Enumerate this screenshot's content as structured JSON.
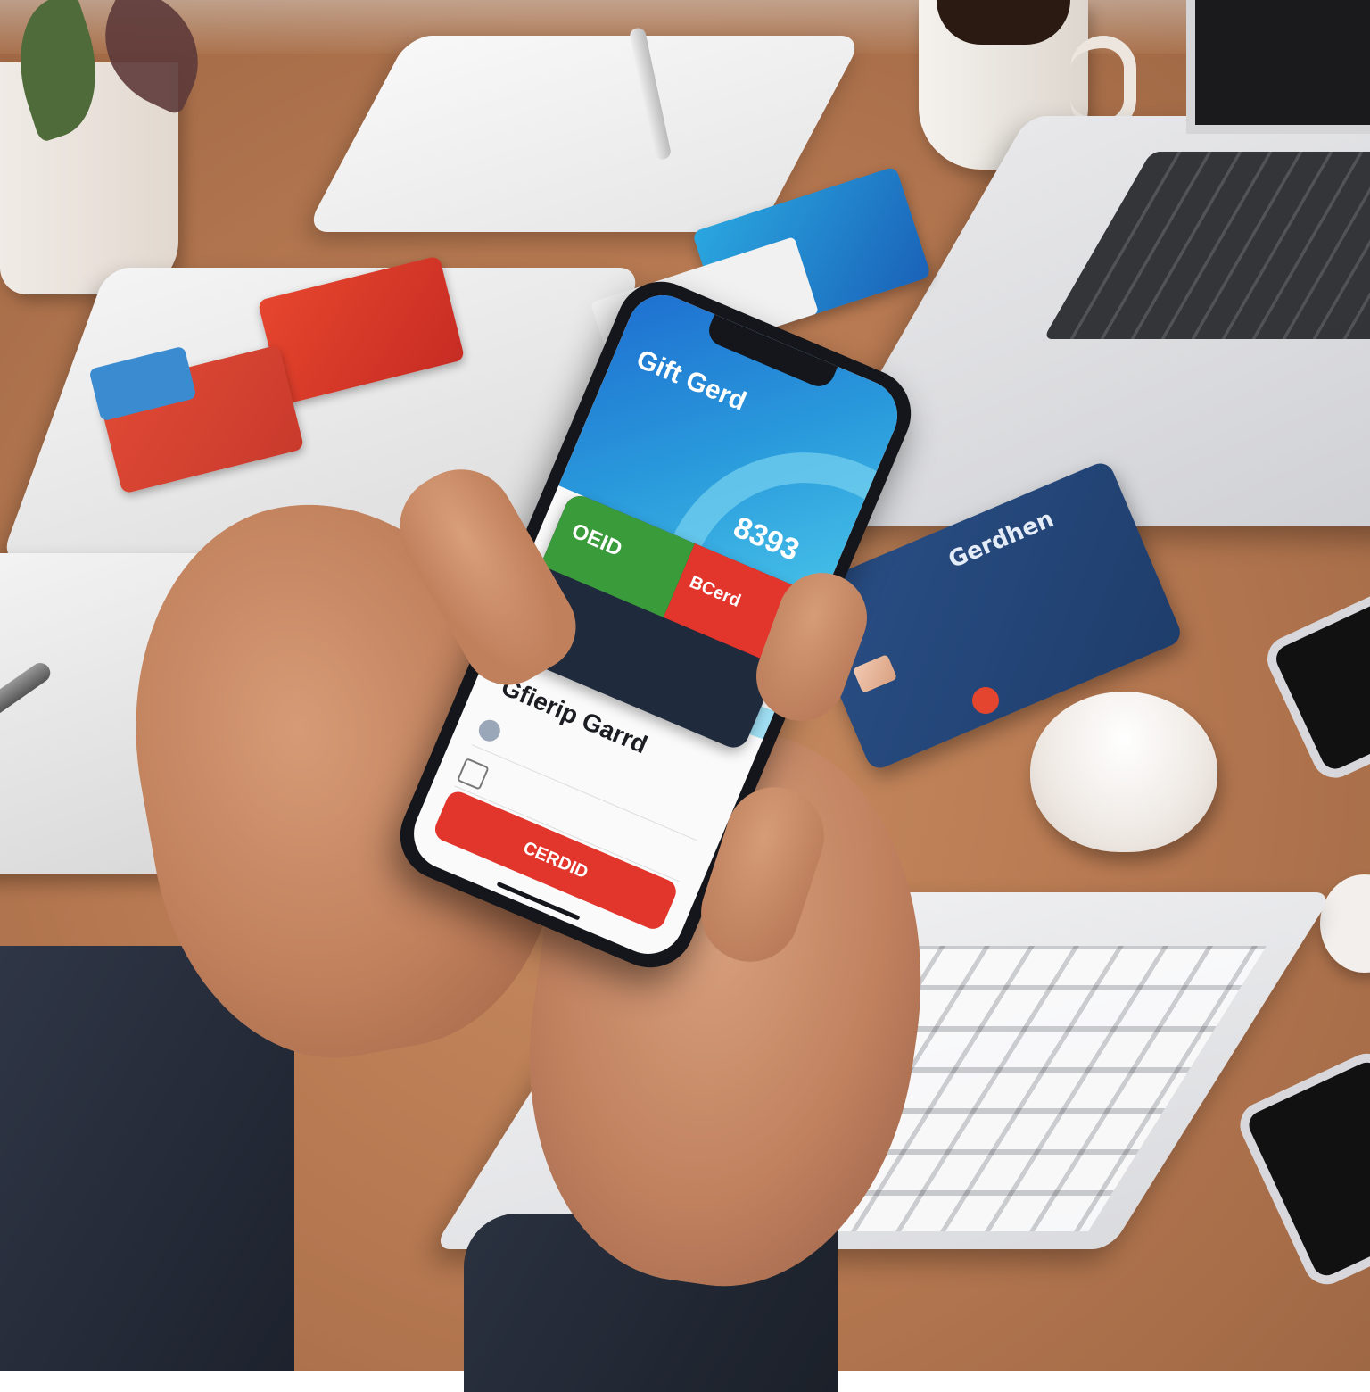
{
  "phone": {
    "hero_card": {
      "title": "Gift Gerd",
      "code": "8393"
    },
    "card_green": {
      "label": "OEID"
    },
    "card_red": {
      "label": "BCerd"
    },
    "app_title": "Gfierip Garrd",
    "cta_button": {
      "label": "CERDID"
    }
  },
  "desk_card_blue": {
    "brand": "Gerdhen"
  },
  "colors": {
    "wood": "#b87a52",
    "phone_blue": "#1e6fd0",
    "phone_green": "#3a9b3a",
    "phone_red": "#e2352c",
    "card_navy": "#1e3d6b"
  }
}
